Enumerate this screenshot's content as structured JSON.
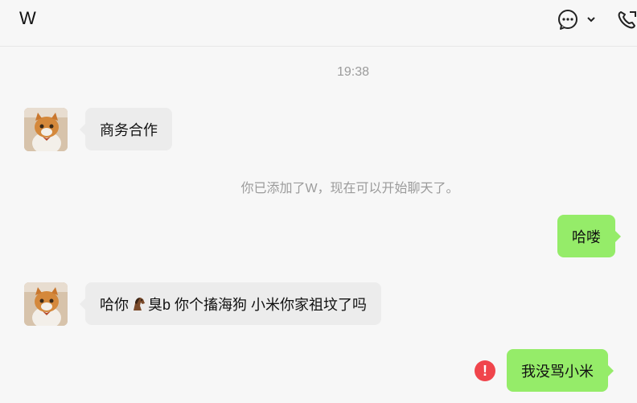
{
  "header": {
    "title": "W",
    "icons": {
      "more": "chat-bubble-icon",
      "dropdown": "chevron-down-icon",
      "call": "phone-icon"
    }
  },
  "messages": {
    "time": "19:38",
    "m1": {
      "text": "商务合作",
      "from": "contact"
    },
    "system": "你已添加了W，现在可以开始聊天了。",
    "m2": {
      "text": "哈喽",
      "from": "me"
    },
    "m3": {
      "pre": "哈你",
      "emoji": "horse-emoji",
      "post": "臭b 你个搐海狗 小米你家祖坟了吗",
      "from": "contact"
    },
    "m4": {
      "text": "我没骂小米",
      "from": "me",
      "status": "failed"
    }
  },
  "colors": {
    "outgoing": "#95ec69",
    "incoming": "#ececec",
    "error": "#f0454c"
  }
}
